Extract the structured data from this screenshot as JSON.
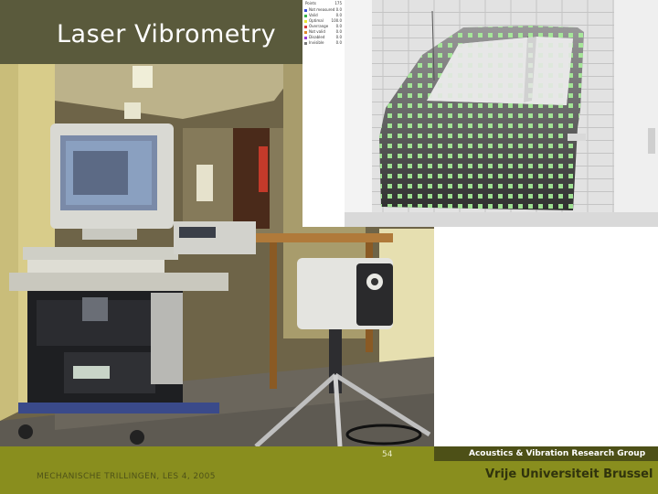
{
  "slide": {
    "title": "Laser Vibrometry",
    "page_number": "54",
    "course_label": "MECHANISCHE TRILLINGEN, LES 4, 2005",
    "group_name": "Acoustics & Vibration Research Group",
    "university": "Vrije Universiteit Brussel"
  },
  "scan_legend": {
    "heading": "Points",
    "heading_value": "175",
    "items": [
      {
        "label": "Not measured",
        "value": "0.0",
        "color": "#3a4fd6"
      },
      {
        "label": "Valid",
        "value": "0.0",
        "color": "#37b34a"
      },
      {
        "label": "Optimal",
        "value": "100.0",
        "color": "#e8e832"
      },
      {
        "label": "Overrange",
        "value": "0.0",
        "color": "#d63a3a"
      },
      {
        "label": "Not valid",
        "value": "0.0",
        "color": "#e08a2e"
      },
      {
        "label": "Disabled",
        "value": "0.0",
        "color": "#9a3ad6"
      },
      {
        "label": "Invisible",
        "value": "0.0",
        "color": "#7a7a7a"
      }
    ]
  },
  "colors": {
    "title_bar": "#5a5a3c",
    "footer": "#898e1e",
    "footer_band": "#4d5017",
    "scan_grid_point": "#a8f09a"
  }
}
